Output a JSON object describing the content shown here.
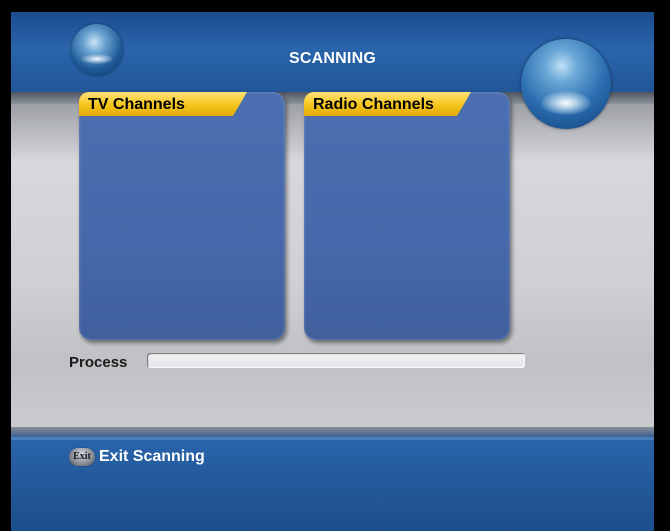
{
  "screen": {
    "title": "SCANNING"
  },
  "panels": {
    "tv": {
      "label": "TV Channels"
    },
    "radio": {
      "label": "Radio Channels"
    }
  },
  "process": {
    "label": "Process",
    "progress": 0
  },
  "footer": {
    "exit_icon_text": "Exit",
    "exit_label": "Exit Scanning"
  },
  "colors": {
    "accent_blue": "#2a64ab",
    "tab_yellow": "#f5c51a",
    "panel_blue": "#4768aa"
  }
}
